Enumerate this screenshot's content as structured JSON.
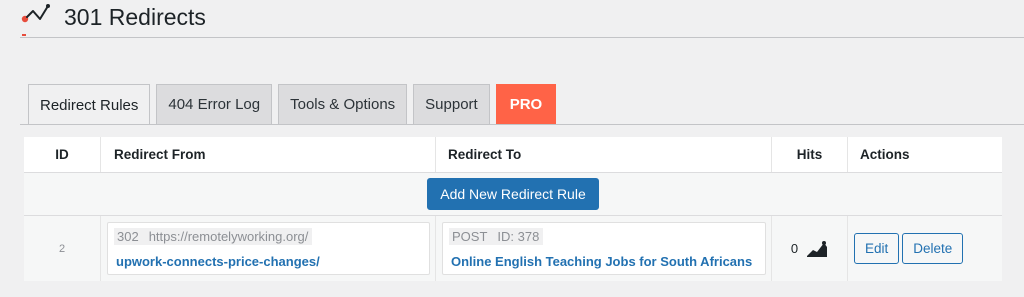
{
  "header": {
    "title": "301 Redirects",
    "logo_icon": "redirect-logo-icon"
  },
  "tabs": [
    {
      "label": "Redirect Rules",
      "active": true
    },
    {
      "label": "404 Error Log",
      "active": false
    },
    {
      "label": "Tools & Options",
      "active": false
    },
    {
      "label": "Support",
      "active": false
    },
    {
      "label": "PRO",
      "active": false
    }
  ],
  "table": {
    "columns": {
      "id": "ID",
      "from": "Redirect From",
      "to": "Redirect To",
      "hits": "Hits",
      "actions": "Actions"
    },
    "add_button": "Add New Redirect Rule",
    "rows": [
      {
        "id": "2",
        "from_status": "302",
        "from_base": "https://remotelyworking.org/",
        "from_path": "upwork-connects-price-changes/",
        "to_type": "POST",
        "to_id": "ID: 378",
        "to_title": "Online English Teaching Jobs for South Africans",
        "hits": "0",
        "hits_icon": "chart-icon",
        "edit_label": "Edit",
        "delete_label": "Delete"
      }
    ]
  },
  "colors": {
    "accent": "#2271b1",
    "pro": "#ff6347",
    "logo": "#e74c3c"
  }
}
